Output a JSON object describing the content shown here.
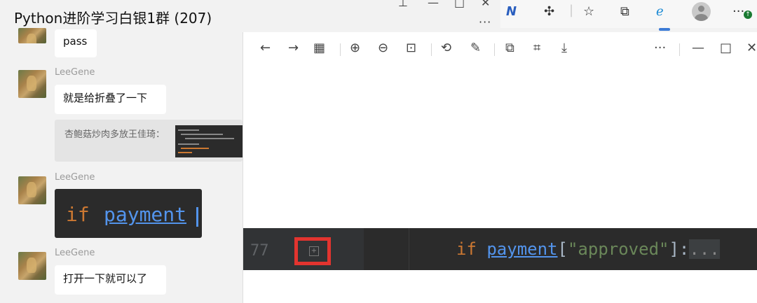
{
  "chat": {
    "title": "Python进阶学习白银1群 (207)",
    "more_label": "···",
    "messages": [
      {
        "sender": "",
        "text": "pass"
      },
      {
        "sender": "LeeGene",
        "text": "就是给折叠了一下"
      },
      {
        "quote": "杏鲍菇炒肉多放王佳琦："
      },
      {
        "sender": "LeeGene",
        "code_keyword": "if",
        "code_var": "payment"
      },
      {
        "sender": "LeeGene",
        "text": "打开一下就可以了"
      }
    ]
  },
  "browser": {
    "more_label": "···",
    "badge": "↑"
  },
  "viewer": {
    "more_label": "···",
    "line_number": "77",
    "code": {
      "keyword": "if",
      "var": "payment",
      "rest_open": "[",
      "string": "\"approved\"",
      "rest_close": "]:",
      "fold": "..."
    }
  },
  "colors": {
    "accent": "#e3342f",
    "keyword": "#cc7832",
    "variable": "#5394ec",
    "string": "#6a8759"
  }
}
